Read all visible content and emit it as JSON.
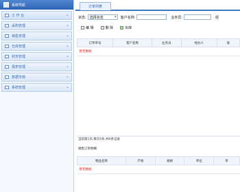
{
  "sidebar": {
    "title": "系统导航",
    "items": [
      {
        "label": "工 作 台",
        "icon": "folder-icon"
      },
      {
        "label": "采购管理",
        "icon": "folder-icon"
      },
      {
        "label": "销售管理",
        "icon": "folder-icon"
      },
      {
        "label": "仓库管理",
        "icon": "folder-icon"
      },
      {
        "label": "财务管理",
        "icon": "folder-icon"
      },
      {
        "label": "报表管理",
        "icon": "folder-icon"
      },
      {
        "label": "数据字典",
        "icon": "folder-icon"
      },
      {
        "label": "系统管理",
        "icon": "folder-icon"
      }
    ]
  },
  "tab": {
    "label": "订单列表"
  },
  "filter": {
    "status_label": "状态:",
    "status_value": "选择状态",
    "customer_label": "客户名称:",
    "salesman_label": "业务员:",
    "operator_label": "经"
  },
  "toolbar": {
    "edit_label": "编 辑",
    "delete_label": "删 除",
    "warehouse_label": "出库"
  },
  "order_table": {
    "columns": [
      "订单单号",
      "客户名称",
      "业务员",
      "经办人",
      "发"
    ],
    "empty_text": "暂无数据"
  },
  "pager": {
    "text": "当前第1页,每页5条,共0条记录"
  },
  "detail": {
    "title": "销售订单明细",
    "columns": [
      "物品名称",
      "产地",
      "规格",
      "单位",
      "单"
    ],
    "empty_text": "暂无数据"
  }
}
